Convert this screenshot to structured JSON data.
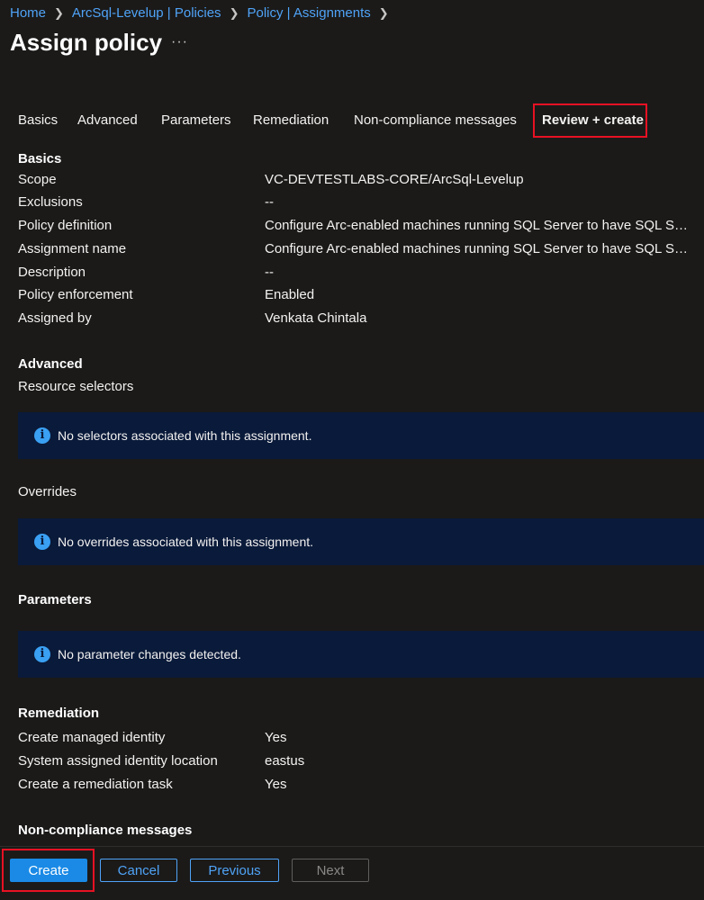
{
  "breadcrumb": [
    "Home",
    "ArcSql-Levelup | Policies",
    "Policy | Assignments"
  ],
  "page": {
    "title": "Assign policy",
    "more": "···"
  },
  "tabs": [
    {
      "label": "Basics"
    },
    {
      "label": "Advanced"
    },
    {
      "label": "Parameters"
    },
    {
      "label": "Remediation"
    },
    {
      "label": "Non-compliance messages"
    },
    {
      "label": "Review + create",
      "active": true
    }
  ],
  "basics": {
    "heading": "Basics",
    "rows": [
      {
        "label": "Scope",
        "value": "VC-DEVTESTLABS-CORE/ArcSql-Levelup"
      },
      {
        "label": "Exclusions",
        "value": "--"
      },
      {
        "label": "Policy definition",
        "value": "Configure Arc-enabled machines running SQL Server to have SQL Server e..."
      },
      {
        "label": "Assignment name",
        "value": "Configure Arc-enabled machines running SQL Server to have SQL Server e..."
      },
      {
        "label": "Description",
        "value": "--"
      },
      {
        "label": "Policy enforcement",
        "value": "Enabled"
      },
      {
        "label": "Assigned by",
        "value": "Venkata Chintala"
      }
    ]
  },
  "advanced": {
    "heading": "Advanced",
    "resource_selectors_label": "Resource selectors",
    "selectors_msg": "No selectors associated with this assignment.",
    "overrides_label": "Overrides",
    "overrides_msg": "No overrides associated with this assignment."
  },
  "parameters": {
    "heading": "Parameters",
    "msg": "No parameter changes detected."
  },
  "remediation": {
    "heading": "Remediation",
    "rows": [
      {
        "label": "Create managed identity",
        "value": "Yes"
      },
      {
        "label": "System assigned identity location",
        "value": "eastus"
      },
      {
        "label": "Create a remediation task",
        "value": "Yes"
      }
    ]
  },
  "noncompliance": {
    "heading": "Non-compliance messages"
  },
  "footer": {
    "create": "Create",
    "cancel": "Cancel",
    "previous": "Previous",
    "next": "Next"
  },
  "icons": {
    "info": "info-icon",
    "chevron": "chevron-right-icon"
  },
  "colors": {
    "background": "#1b1a19",
    "link": "#4fa3f7",
    "primary": "#1a8ae6",
    "info_bg": "#0a1a3a",
    "highlight": "#e81123"
  }
}
